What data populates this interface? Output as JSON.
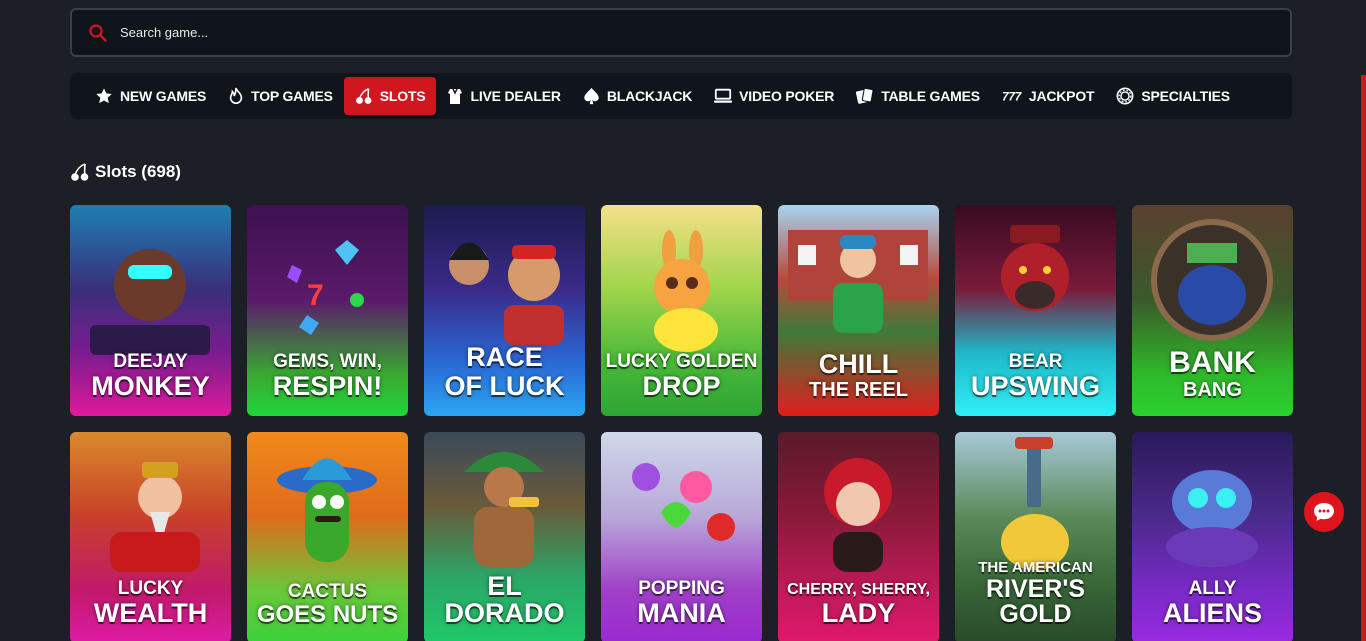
{
  "search": {
    "placeholder": "Search game..."
  },
  "nav": [
    {
      "label": "NEW GAMES",
      "icon": "star-icon"
    },
    {
      "label": "TOP GAMES",
      "icon": "flame-icon"
    },
    {
      "label": "SLOTS",
      "icon": "cherry-icon",
      "active": true
    },
    {
      "label": "LIVE DEALER",
      "icon": "dealer-icon"
    },
    {
      "label": "BLACKJACK",
      "icon": "spade-icon"
    },
    {
      "label": "VIDEO POKER",
      "icon": "monitor-icon"
    },
    {
      "label": "TABLE GAMES",
      "icon": "cards-icon"
    },
    {
      "label": "JACKPOT",
      "icon": "seven-icon"
    },
    {
      "label": "SPECIALTIES",
      "icon": "chip-icon"
    }
  ],
  "section": {
    "title": "Slots (698)"
  },
  "games": [
    {
      "line1": "DEEJAY",
      "line2": "MONKEY"
    },
    {
      "line1": "GEMS, WIN,",
      "line2": "RESPIN!"
    },
    {
      "line1": "RACE",
      "line2": "OF LUCK"
    },
    {
      "line1": "LUCKY GOLDEN",
      "line2": "DROP"
    },
    {
      "line1": "CHILL",
      "line2": "THE REEL"
    },
    {
      "line1": "BEAR",
      "line2": "UPSWING"
    },
    {
      "line1": "BANK",
      "line2": "BANG"
    },
    {
      "line1": "LUCKY",
      "line2": "WEALTH"
    },
    {
      "line1": "CACTUS",
      "line2": "GOES NUTS"
    },
    {
      "line1": "",
      "line2": "EL DORADO"
    },
    {
      "line1": "POPPING",
      "line2": "MANIA"
    },
    {
      "line1": "CHERRY, SHERRY,",
      "line2": "LADY"
    },
    {
      "line1": "THE AMERICAN",
      "line2": "RIVER'S GOLD"
    },
    {
      "line1": "ALLY",
      "line2": "ALIENS"
    }
  ],
  "colors": {
    "accent": "#d0161f",
    "background": "#1c1f26",
    "panel": "#10141b"
  }
}
